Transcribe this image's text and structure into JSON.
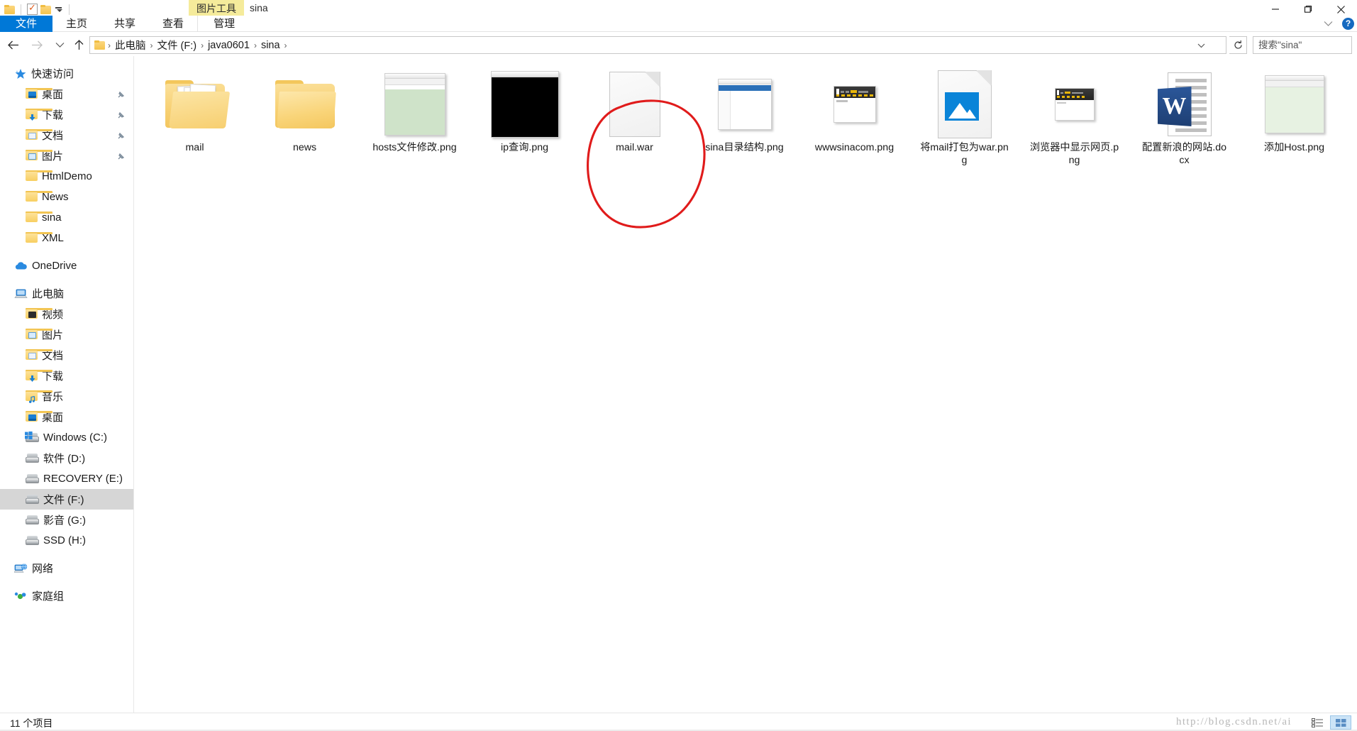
{
  "window": {
    "title": "sina",
    "contextual_tab": "图片工具",
    "quick_access": [
      "folder-icon",
      "properties-icon",
      "new-folder-icon",
      "customize-qat-dropdown"
    ],
    "controls": {
      "minimize": "minimize-icon",
      "maximize": "maximize-icon",
      "close": "close-icon"
    }
  },
  "ribbon": {
    "tabs": [
      {
        "label": "文件",
        "active": true
      },
      {
        "label": "主页",
        "active": false
      },
      {
        "label": "共享",
        "active": false
      },
      {
        "label": "查看",
        "active": false
      },
      {
        "label": "管理",
        "active": false,
        "contextual": true
      }
    ],
    "collapse_icon": "chevron-down-icon",
    "help_label": "?"
  },
  "address": {
    "back_icon": "arrow-left-icon",
    "forward_icon": "arrow-right-icon",
    "recent_icon": "chevron-down-icon",
    "up_icon": "arrow-up-icon",
    "crumbs": [
      "此电脑",
      "文件 (F:)",
      "java0601",
      "sina"
    ],
    "separator": "›",
    "dropdown_icon": "chevron-down-icon",
    "refresh_icon": "refresh-icon"
  },
  "search": {
    "placeholder": "搜索\"sina\"",
    "value": "",
    "icon": "search-icon"
  },
  "sidebar": {
    "groups": [
      {
        "header": {
          "label": "快速访问",
          "icon": "star-icon"
        },
        "items": [
          {
            "label": "桌面",
            "icon": "folder-desktop-icon",
            "pinned": true
          },
          {
            "label": "下载",
            "icon": "folder-downloads-icon",
            "pinned": true
          },
          {
            "label": "文档",
            "icon": "folder-documents-icon",
            "pinned": true
          },
          {
            "label": "图片",
            "icon": "folder-pictures-icon",
            "pinned": true
          },
          {
            "label": "HtmlDemo",
            "icon": "folder-icon",
            "pinned": false
          },
          {
            "label": "News",
            "icon": "folder-icon",
            "pinned": false
          },
          {
            "label": "sina",
            "icon": "folder-icon",
            "pinned": false
          },
          {
            "label": "XML",
            "icon": "folder-icon",
            "pinned": false
          }
        ]
      },
      {
        "header": {
          "label": "OneDrive",
          "icon": "cloud-icon"
        },
        "items": []
      },
      {
        "header": {
          "label": "此电脑",
          "icon": "this-pc-icon"
        },
        "items": [
          {
            "label": "视频",
            "icon": "folder-videos-icon",
            "pinned": false
          },
          {
            "label": "图片",
            "icon": "folder-pictures-icon",
            "pinned": false
          },
          {
            "label": "文档",
            "icon": "folder-documents-icon",
            "pinned": false
          },
          {
            "label": "下载",
            "icon": "folder-downloads-icon",
            "pinned": false
          },
          {
            "label": "音乐",
            "icon": "folder-music-icon",
            "pinned": false
          },
          {
            "label": "桌面",
            "icon": "folder-desktop-icon",
            "pinned": false
          },
          {
            "label": "Windows (C:)",
            "icon": "drive-windows-icon",
            "pinned": false
          },
          {
            "label": "软件 (D:)",
            "icon": "drive-icon",
            "pinned": false
          },
          {
            "label": "RECOVERY (E:)",
            "icon": "drive-icon",
            "pinned": false
          },
          {
            "label": "文件 (F:)",
            "icon": "drive-icon",
            "pinned": false,
            "selected": true
          },
          {
            "label": "影音 (G:)",
            "icon": "drive-icon",
            "pinned": false
          },
          {
            "label": "SSD (H:)",
            "icon": "drive-icon",
            "pinned": false
          }
        ]
      },
      {
        "header": {
          "label": "网络",
          "icon": "network-icon"
        },
        "items": []
      },
      {
        "header": {
          "label": "家庭组",
          "icon": "homegroup-icon"
        },
        "items": []
      }
    ]
  },
  "files": [
    {
      "name": "mail",
      "kind": "folder-open-with-files",
      "selected": false
    },
    {
      "name": "news",
      "kind": "folder-empty",
      "selected": false
    },
    {
      "name": "hosts文件修改.png",
      "kind": "thumb-notepad",
      "selected": false
    },
    {
      "name": "ip查询.png",
      "kind": "thumb-console",
      "selected": false
    },
    {
      "name": "mail.war",
      "kind": "blank-document",
      "selected": false,
      "annotated": true
    },
    {
      "name": "sina目录结构.png",
      "kind": "thumb-explorer",
      "selected": false
    },
    {
      "name": "wwwsinacom.png",
      "kind": "thumb-website",
      "selected": false
    },
    {
      "name": "将mail打包为war.png",
      "kind": "image-placeholder",
      "selected": false
    },
    {
      "name": "浏览器中显示网页.png",
      "kind": "thumb-website-small",
      "selected": false
    },
    {
      "name": "配置新浪的网站.docx",
      "kind": "word-document",
      "selected": false
    },
    {
      "name": "添加Host.png",
      "kind": "thumb-code",
      "selected": false
    }
  ],
  "annotation": {
    "type": "hand-drawn-circle",
    "color": "#e01b1b",
    "target": "mail.war"
  },
  "status": {
    "item_count": "11 个项目",
    "watermark": "http://blog.csdn.net/ai",
    "views": [
      {
        "icon": "details-view-icon",
        "active": false
      },
      {
        "icon": "large-icons-view-icon",
        "active": true
      }
    ]
  }
}
